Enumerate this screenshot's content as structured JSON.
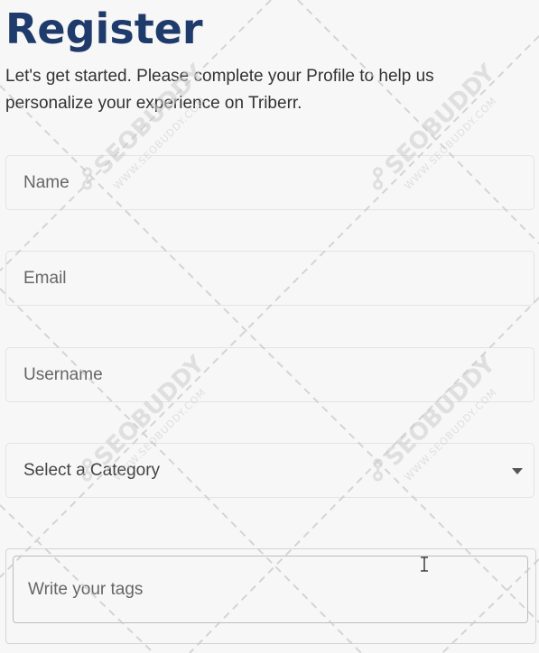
{
  "form": {
    "title": "Register",
    "subtitle": "Let's get started. Please complete your Profile to help us personalize your experience on Triberr.",
    "name_placeholder": "Name",
    "email_placeholder": "Email",
    "username_placeholder": "Username",
    "category_label": "Select a Category",
    "tags_placeholder": "Write your tags"
  },
  "watermark": {
    "brand": "SEOBUDDY",
    "url": "WWW.SEOBUDDY.COM"
  },
  "icons": {
    "category_caret": "caret-down-icon",
    "cursor": "text-cursor-icon",
    "watermark_logo": "seobuddy-logo-icon"
  },
  "colors": {
    "title": "#1f3b6b",
    "background": "#f7f7f7",
    "field_border": "#e3e3e3"
  }
}
